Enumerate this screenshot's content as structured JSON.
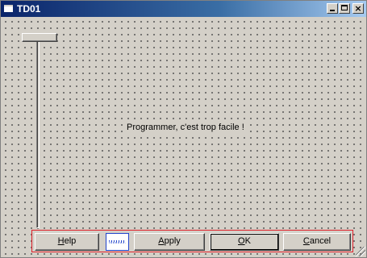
{
  "window": {
    "title": "TD01",
    "minimize_glyph": "_",
    "maximize_glyph": "□",
    "close_glyph": "×"
  },
  "form": {
    "trackbar": {
      "position": 0
    },
    "label": "Programmer, c'est trop facile !"
  },
  "buttons": {
    "help": {
      "accel": "H",
      "rest": "elp"
    },
    "apply": {
      "accel": "A",
      "rest": "pply"
    },
    "ok": {
      "accel": "O",
      "rest": "K"
    },
    "cancel": {
      "accel": "C",
      "rest": "ancel"
    }
  },
  "colors": {
    "title_start": "#0a246a",
    "title_end": "#a6caf0",
    "face": "#d4d0c8",
    "button_bar_border": "#e0202a",
    "spring_border": "#2244cc"
  },
  "icons": {
    "title": "window-icon",
    "spring": "spring-icon",
    "grip": "resize-grip-icon"
  }
}
